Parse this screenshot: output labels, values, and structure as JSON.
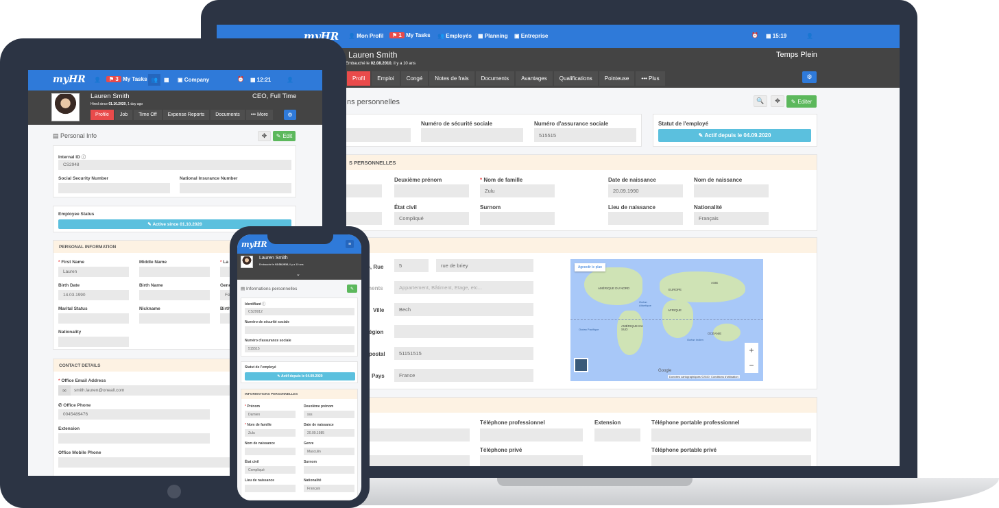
{
  "brand": "myHR",
  "laptop": {
    "nav": {
      "profile": "Mon Profil",
      "tasks_count": "1",
      "tasks": "My Tasks",
      "employees": "Employés",
      "planning": "Planning",
      "company": "Entreprise",
      "time": "15:19"
    },
    "employee": {
      "name": "Lauren Smith",
      "hired": "Embauché le ",
      "hired_date": "02.08.2010",
      "hired_suffix": ", il y a 10 ans",
      "type": "Temps Plein"
    },
    "tabs": [
      "Profil",
      "Emploi",
      "Congé",
      "Notes de frais",
      "Documents",
      "Avantages",
      "Qualifications",
      "Pointeuse",
      "••• Plus"
    ],
    "section_title": "ns personnelles",
    "edit": "Editer",
    "ssn_label": "Numéro de sécurité sociale",
    "nin_label": "Numéro d'assurance sociale",
    "nin_value": "515515",
    "status_label": "Statut de l'employé",
    "status_button": "Actif depuis le 04.09.2020",
    "personal_header": "ONNELLES",
    "personal_header_full": "S PERSONNELLES",
    "fields": {
      "middle_name": "Deuxième prénom",
      "last_name": "Nom de famille",
      "last_name_value": "Zulu",
      "birth_date": "Date de naissance",
      "birth_date_value": "20.09.1990",
      "birth_name": "Nom de naissance",
      "marital": "État civil",
      "marital_value": "Compliqué",
      "nickname": "Surnom",
      "birth_place": "Lieu de naissance",
      "nationality": "Nationalité",
      "nationality_value": "Français"
    },
    "address": {
      "street_label": "o, Rue",
      "number": "5",
      "street": "rue de briey",
      "complement_label": "ments",
      "complement_placeholder": "Appartement, Bâtiment, Etage, etc...",
      "city_label": "Ville",
      "city": "Bech",
      "region_label": "égion",
      "postal_label": "postal",
      "postal": "51151515",
      "country_label": "Pays",
      "country": "France"
    },
    "map": {
      "enlarge": "Agrandir le plan",
      "google": "Google",
      "credits": "Données cartographiques ©2020",
      "terms": "Conditions d'utilisation",
      "labels": [
        "AMÉRIQUE DU NORD",
        "EUROPE",
        "ASIE",
        "AFRIQUE",
        "AMÉRIQUE DU SUD",
        "OCÉANIE",
        "Océan Atlantique",
        "Océan Pacifique",
        "Océan Indien"
      ]
    },
    "contact": {
      "work_phone": "Téléphone professionnel",
      "extension": "Extension",
      "work_mobile": "Téléphone portable professionnel",
      "private_phone": "Téléphone privé",
      "private_mobile": "Téléphone portable privé",
      "email_partial": "n"
    }
  },
  "tablet": {
    "nav": {
      "tasks_count": "3",
      "tasks": "My Tasks",
      "company": "Company",
      "time": "12:21"
    },
    "employee": {
      "name": "Lauren Smith",
      "hired": "Hired since ",
      "hired_date": "01.10.2020",
      "hired_suffix": ", 1 day ago",
      "title": "CEO, Full Time"
    },
    "tabs": [
      "Profile",
      "Job",
      "Time Off",
      "Expense Reports",
      "Documents",
      "••• More"
    ],
    "section_title": "Personal Info",
    "edit": "Edit",
    "internal_id_label": "Internal ID",
    "internal_id": "CS2948",
    "ssn_label": "Social Security Number",
    "nin_label": "National Insurance Number",
    "status_label": "Employee Status",
    "status_button": "Active since 01.10.2020",
    "personal_header": "PERSONAL INFORMATION",
    "fields": {
      "first_name": "First Name",
      "first_name_value": "Lauren",
      "middle_name": "Middle Name",
      "last_name": "La",
      "birth_date": "Birth Date",
      "birth_date_value": "14.03.1990",
      "birth_name": "Birth Name",
      "gender": "Gend",
      "marital": "Marital Status",
      "nickname": "Nickname",
      "birth_place": "Birth",
      "nationality": "Nationality",
      "gender_value": "Fé"
    },
    "contact_header": "CONTACT DETAILS",
    "contact": {
      "email_label": "Office Email Address",
      "email": "smith.lauren@oneall.com",
      "office_phone_label": "Office Phone",
      "office_phone": "0045489476",
      "extension_label": "Extension",
      "mobile_label": "Office Mobile Phone"
    }
  },
  "phone": {
    "employee": {
      "name": "Lauren Smith",
      "hired": "Embauché le ",
      "hired_date": "02.08.2010",
      "hired_suffix": ", il y a 10 ans"
    },
    "section_title": "Informations personnelles",
    "id_label": "Identifiant",
    "id_value": "CS29912",
    "ssn_label": "Numéro de sécurité sociale",
    "nin_label": "Numéro d'assurance sociale",
    "nin_value": "515515",
    "status_label": "Statut de l'employé",
    "status_button": "Actif depuis le 04.09.2020",
    "personal_header": "INFORMATIONS PERSONNELLES",
    "fields": {
      "first_name": "Prénom",
      "first_name_value": "Damien",
      "middle_name": "Deuxième prénom",
      "middle_name_value": "sss",
      "last_name": "Nom de famille",
      "last_name_value": "Zulu",
      "birth_date": "Date de naissance",
      "birth_date_value": "20.09.1985",
      "birth_name": "Nom de naissance",
      "gender": "Genre",
      "gender_value": "Masculin",
      "marital": "État civil",
      "marital_value": "Compliqué",
      "nickname": "Surnom",
      "birth_place": "Lieu de naissance",
      "nationality": "Nationalité",
      "nationality_value": "Français"
    }
  },
  "colors": {
    "brand_blue": "#2f7ad9",
    "accent_red": "#e94b4b",
    "success_green": "#5cb85c",
    "status_cyan": "#5bc0de",
    "device_frame": "#2c3444"
  }
}
